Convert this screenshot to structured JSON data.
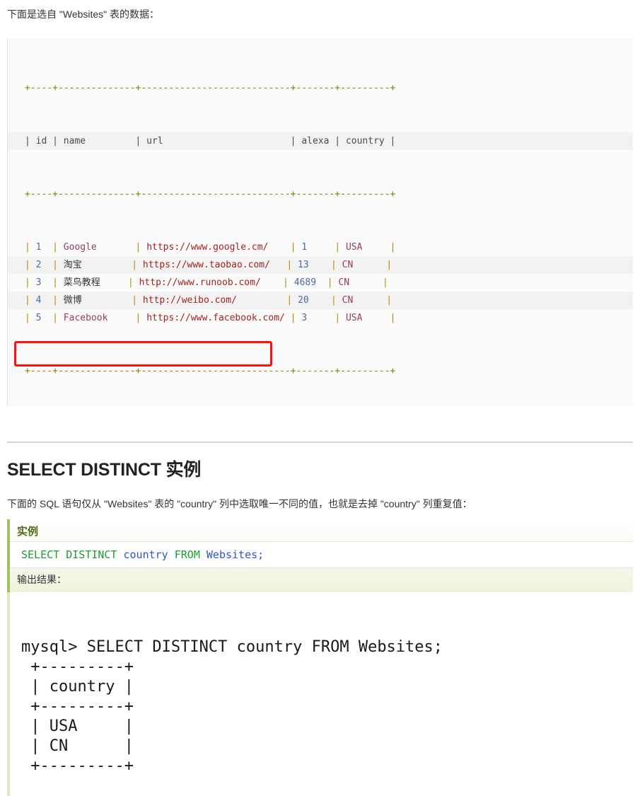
{
  "intro": "下面是选自 \"Websites\" 表的数据：",
  "websites_table": {
    "rule": "+----+--------------+---------------------------+-------+---------+",
    "header": "| id | name         | url                       | alexa | country |",
    "columns": [
      "id",
      "name",
      "url",
      "alexa",
      "country"
    ],
    "rows": [
      {
        "id": "1",
        "name": "Google",
        "name_script": "latin",
        "url": "https://www.google.cm/",
        "alexa": "1",
        "country": "USA"
      },
      {
        "id": "2",
        "name": "淘宝",
        "name_script": "cjk",
        "url": "https://www.taobao.com/",
        "alexa": "13",
        "country": "CN"
      },
      {
        "id": "3",
        "name": "菜鸟教程",
        "name_script": "cjk",
        "url": "http://www.runoob.com/",
        "alexa": "4689",
        "country": "CN"
      },
      {
        "id": "4",
        "name": "微博",
        "name_script": "cjk",
        "url": "http://weibo.com/",
        "alexa": "20",
        "country": "CN"
      },
      {
        "id": "5",
        "name": "Facebook",
        "name_script": "latin",
        "url": "https://www.facebook.com/",
        "alexa": "3",
        "country": "USA"
      }
    ]
  },
  "section": {
    "title": "SELECT DISTINCT 实例",
    "description": "下面的 SQL 语句仅从 \"Websites\" 表的 \"country\" 列中选取唯一不同的值，也就是去掉 \"country\" 列重复值："
  },
  "example": {
    "label": "实例",
    "sql": {
      "keyword1": "SELECT DISTINCT",
      "identifier1": "country",
      "keyword2": "FROM",
      "identifier2": "Websites",
      "terminator": ";",
      "full": "SELECT DISTINCT country FROM Websites;"
    },
    "highlight_color": "#ff1111",
    "keyword_color": "#1a9e2e",
    "identifier_color": "#2b55d4"
  },
  "output": {
    "label": "输出结果：",
    "prompt": "mysql>",
    "command": "SELECT DISTINCT country FROM Websites;",
    "rule": "+---------+",
    "header": "| country |",
    "rows": [
      "| USA     |",
      "| CN      |"
    ],
    "lines": [
      "mysql> SELECT DISTINCT country FROM Websites;",
      " +---------+",
      " | country |",
      " +---------+",
      " | USA     |",
      " | CN      |",
      " +---------+"
    ]
  }
}
